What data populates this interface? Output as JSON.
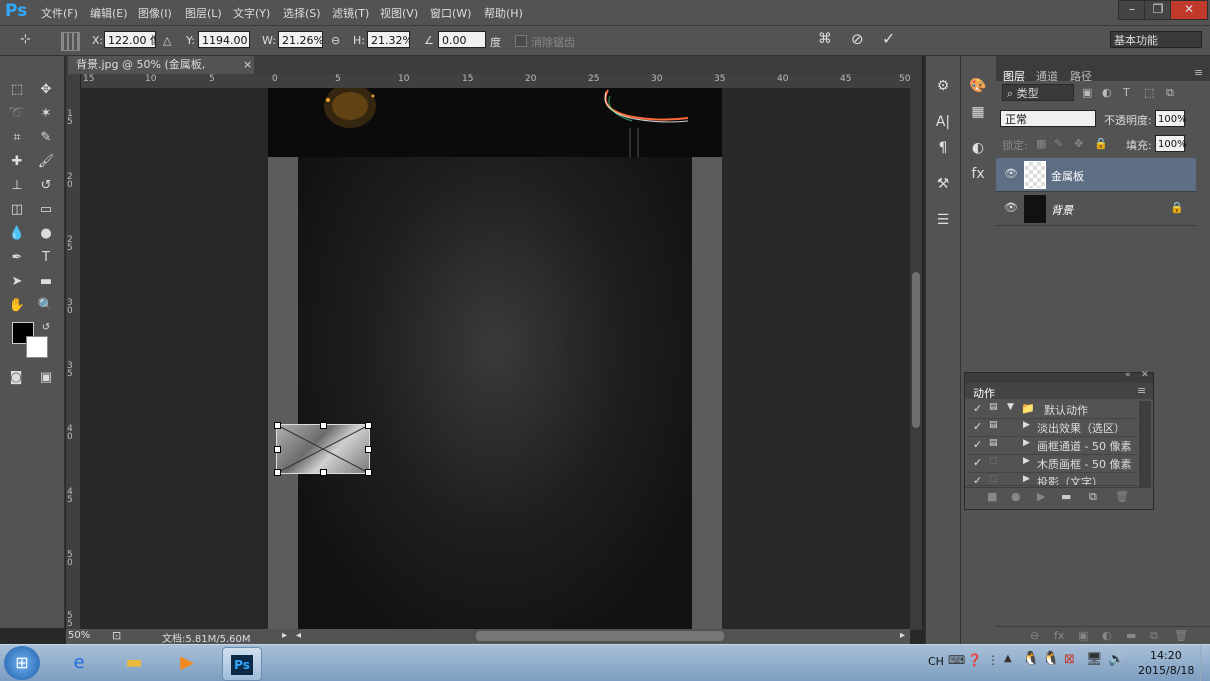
{
  "app": {
    "logo": "Ps"
  },
  "menu": [
    "文件(F)",
    "编辑(E)",
    "图像(I)",
    "图层(L)",
    "文字(Y)",
    "选择(S)",
    "滤镜(T)",
    "视图(V)",
    "窗口(W)",
    "帮助(H)"
  ],
  "window_controls": {
    "minimize": "–",
    "restore": "❐",
    "close": "✕"
  },
  "options": {
    "x_label": "X:",
    "x_value": "122.00 像",
    "y_label": "Y:",
    "y_value": "1194.00 像",
    "w_label": "W:",
    "w_value": "21.26%",
    "h_label": "H:",
    "h_value": "21.32%",
    "angle_value": "0.00",
    "angle_unit": "度",
    "antialias_label": "消除锯齿",
    "workspace": "基本功能"
  },
  "document": {
    "tab_title": "背景.jpg @ 50% (金属板, RGB/8#)",
    "close": "×"
  },
  "ruler": {
    "h": [
      "15",
      "10",
      "5",
      "0",
      "5",
      "10",
      "15",
      "20",
      "25",
      "30",
      "35",
      "40",
      "45",
      "50"
    ],
    "v": [
      "1 5",
      "2 0",
      "2 5",
      "3 0",
      "3 5",
      "4 0",
      "4 5",
      "5 0",
      "5 5"
    ]
  },
  "status": {
    "zoom": "50%",
    "doc_info": "文档:5.81M/5.60M"
  },
  "layers_panel": {
    "tabs": [
      "图层",
      "通道",
      "路径"
    ],
    "filter_kind": "类型",
    "blend_mode": "正常",
    "opacity_label": "不透明度:",
    "opacity_value": "100%",
    "lock_label": "锁定:",
    "fill_label": "填充:",
    "fill_value": "100%",
    "layers": [
      {
        "name": "金属板",
        "selected": true
      },
      {
        "name": "背景",
        "italic": true
      }
    ]
  },
  "actions_panel": {
    "title": "动作",
    "items": [
      {
        "label": "默认动作",
        "type": "folder"
      },
      {
        "label": "淡出效果（选区）",
        "type": "action"
      },
      {
        "label": "画框通道 - 50 像素",
        "type": "action"
      },
      {
        "label": "木质画框 - 50 像素",
        "type": "action"
      },
      {
        "label": "投影（文字）",
        "type": "action"
      }
    ]
  },
  "taskbar": {
    "lang": "CH",
    "time": "14:20",
    "date": "2015/8/18"
  },
  "colors": {
    "accent": "#31a8ff",
    "selected_layer": "#5e6e85",
    "panel": "#535353"
  }
}
